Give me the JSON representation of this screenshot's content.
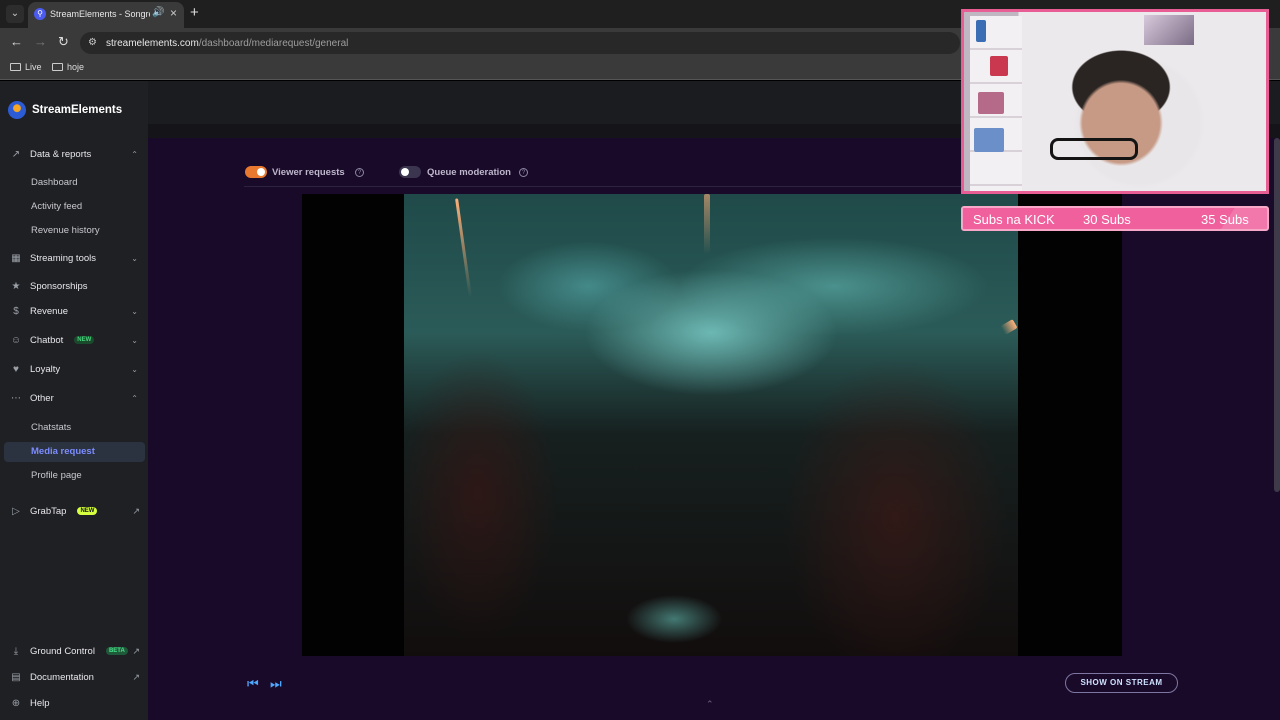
{
  "browser": {
    "tab_title": "StreamElements - Songrequest",
    "tab_close": "×",
    "new_tab": "+",
    "url_host": "streamelements.com",
    "url_path": "/dashboard/mediarequest/general",
    "bookmarks": [
      "Live",
      "hoje"
    ]
  },
  "sidebar": {
    "brand": "StreamElements",
    "sections": {
      "data_reports": "Data & reports",
      "dashboard": "Dashboard",
      "activity_feed": "Activity feed",
      "revenue_history": "Revenue history",
      "streaming_tools": "Streaming tools",
      "sponsorships": "Sponsorships",
      "revenue": "Revenue",
      "chatbot": "Chatbot",
      "chatbot_badge": "NEW",
      "loyalty": "Loyalty",
      "other": "Other",
      "chatstats": "Chatstats",
      "media_request": "Media request",
      "profile_page": "Profile page",
      "grabtap": "GrabTap",
      "grabtap_badge": "NEW"
    },
    "footer": {
      "ground_control": "Ground Control",
      "ground_control_badge": "BETA",
      "documentation": "Documentation",
      "help": "Help"
    }
  },
  "media": {
    "viewer_requests_label": "Viewer requests",
    "viewer_requests_on": true,
    "queue_moderation_label": "Queue moderation",
    "queue_moderation_on": false,
    "show_on_stream": "SHOW ON STREAM"
  },
  "overlay": {
    "subs_label": "Subs na KICK",
    "current": "30 Subs",
    "goal": "35 Subs",
    "frame_color": "#e85d93",
    "bar_color": "#f0609d"
  },
  "colors": {
    "accent": "#7b8cff",
    "toggle_on": "#e8792f",
    "main_bg": "#1a0a2a"
  }
}
